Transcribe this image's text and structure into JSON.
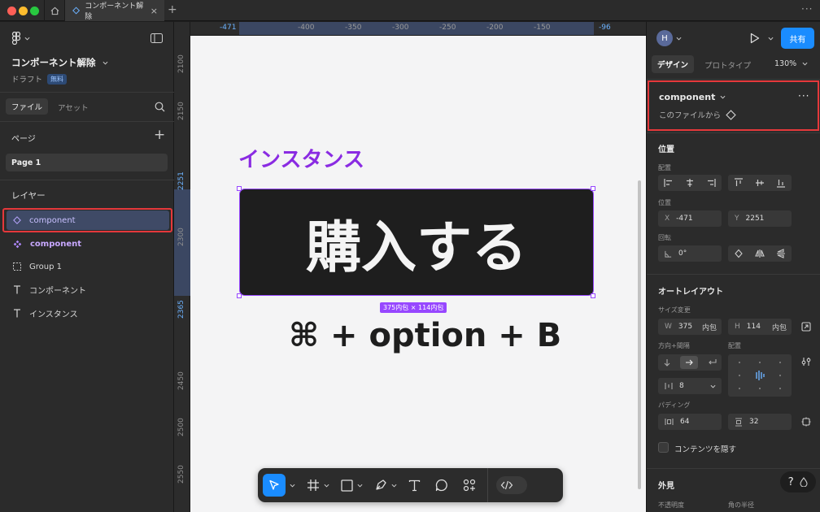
{
  "window": {
    "tab_title": "コンポーネント解除",
    "tab_close": "×",
    "tab_add": "+",
    "more": "···"
  },
  "left_panel": {
    "file_title": "コンポーネント解除",
    "status": "ドラフト",
    "plan_badge": "無料",
    "tabs": [
      "ファイル",
      "アセット"
    ],
    "pages_header": "ページ",
    "pages_add": "+",
    "pages": [
      "Page 1"
    ],
    "layers_header": "レイヤー",
    "layers": [
      {
        "label": "component",
        "icon": "diamond-outline-icon",
        "selected": true
      },
      {
        "label": "component",
        "icon": "component-icon",
        "selected": false
      },
      {
        "label": "Group 1",
        "icon": "group-dashed-icon",
        "selected": false
      },
      {
        "label": "コンポーネント",
        "icon": "text-icon",
        "selected": false
      },
      {
        "label": "インスタンス",
        "icon": "text-icon",
        "selected": false
      }
    ]
  },
  "ruler": {
    "top_ticks": [
      "-471",
      "-400",
      "-350",
      "-300",
      "-250",
      "-200",
      "-150",
      "-96"
    ],
    "left_ticks": [
      "2100",
      "2150",
      "2251",
      "2300",
      "2365",
      "2450",
      "2500",
      "2550"
    ]
  },
  "canvas": {
    "heading": "インスタンス",
    "button_text": "購入する",
    "size_label": "375内包 × 114内包",
    "shortcut_text": "⌘ + option + B"
  },
  "toolbar": {
    "tools": [
      "move-tool",
      "frame-tool",
      "shape-tool",
      "pen-tool",
      "text-tool",
      "comment-tool",
      "actions-tool",
      "dev-mode-toggle"
    ]
  },
  "right_panel": {
    "avatar": "H",
    "share_label": "共有",
    "tabs": [
      "デザイン",
      "プロトタイプ"
    ],
    "zoom": "130%",
    "component": {
      "name": "component",
      "source": "このファイルから",
      "more": "···"
    },
    "position": {
      "title": "位置",
      "align_label": "配置",
      "position_label": "位置",
      "x_label": "X",
      "x": "-471",
      "y_label": "Y",
      "y": "2251",
      "rotation_label": "回転",
      "rotation": "0°"
    },
    "auto_layout": {
      "title": "オートレイアウト",
      "size_label": "サイズ変更",
      "w_label": "W",
      "w": "375",
      "w_mode": "内包",
      "h_label": "H",
      "h": "114",
      "h_mode": "内包",
      "direction_label": "方向+間隔",
      "align_label": "配置",
      "gap": "8",
      "padding_label": "パディング",
      "padding_h": "64",
      "padding_v": "32",
      "clip_label": "コンテンツを隠す"
    },
    "appearance": {
      "title": "外見",
      "opacity_label": "不透明度",
      "radius_label": "角の半径"
    },
    "help": "?"
  },
  "colors": {
    "accent_blue": "#1a8cff",
    "highlight_red": "#e5383b",
    "selection_purple": "#9747ff",
    "heading_purple": "#8a2be2"
  }
}
